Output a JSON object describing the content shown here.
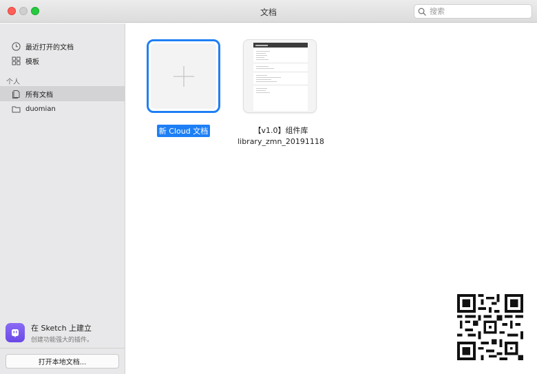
{
  "window": {
    "title": "文档"
  },
  "search": {
    "placeholder": "搜索"
  },
  "sidebar": {
    "items": [
      {
        "label": "最近打开的文档",
        "icon": "clock-icon"
      },
      {
        "label": "模板",
        "icon": "template-grid-icon"
      }
    ],
    "section_label": "个人",
    "personal_items": [
      {
        "label": "所有文档",
        "icon": "documents-icon",
        "selected": true
      },
      {
        "label": "duomian",
        "icon": "folder-icon",
        "selected": false
      }
    ],
    "promo": {
      "title": "在 Sketch 上建立",
      "subtitle": "创建功能强大的插件。",
      "icon": "plug-icon"
    },
    "open_local_button": "打开本地文档..."
  },
  "main": {
    "new_document": {
      "label": "新 Cloud 文档",
      "icon": "plus-icon"
    },
    "documents": [
      {
        "title_line1": "【v1.0】组件库",
        "title_line2": "library_zmn_20191118"
      }
    ]
  },
  "colors": {
    "accent": "#1e7ff5",
    "sidebar_bg": "#e8e8ea",
    "promo_icon": "#7a5af0"
  }
}
